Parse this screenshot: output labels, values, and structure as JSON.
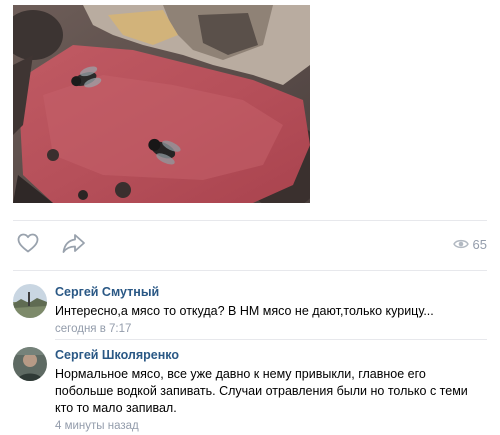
{
  "post": {
    "views_count": "65"
  },
  "icons": {
    "like": "heart-icon",
    "share": "share-arrow-icon",
    "views": "eye-icon"
  },
  "colors": {
    "link": "#2a5885",
    "meta": "#939cab",
    "divider": "#e7e8ec",
    "icon": "#99a2ad"
  },
  "comments": [
    {
      "author": "Сергей Смутный",
      "text": "Интересно,а мясо то откуда? В НМ мясо не дают,только курицу...",
      "time": "сегодня в 7:17"
    },
    {
      "author": "Сергей Школяренко",
      "text": "Нормальное мясо, все уже давно к нему привыкли, главное его побольше водкой запивать. Случаи отравления были но только с теми кто то мало запивал.",
      "time": "4 минуты назад"
    }
  ]
}
